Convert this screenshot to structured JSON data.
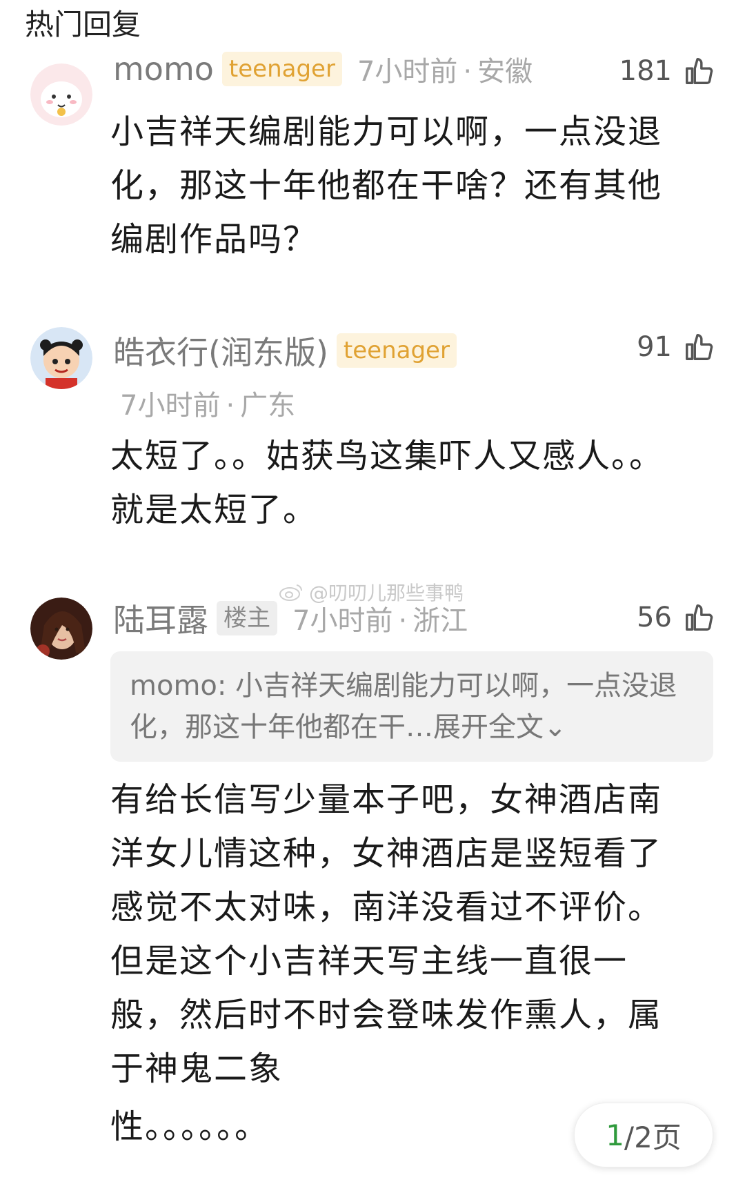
{
  "header": {
    "title": "热门回复"
  },
  "comments": [
    {
      "username": "momo",
      "badge": "teenager",
      "time": "7小时前",
      "location": "安徽",
      "likes": "181",
      "text": "小吉祥天编剧能力可以啊，一点没退化，那这十年他都在干啥？还有其他编剧作品吗？"
    },
    {
      "username": "皓衣行(润东版)",
      "badge": "teenager",
      "time": "7小时前",
      "location": "广东",
      "likes": "91",
      "text": "太短了。。姑获鸟这集吓人又感人。。就是太短了。"
    },
    {
      "username": "陆耳露",
      "badge": "楼主",
      "time": "7小时前",
      "location": "浙江",
      "likes": "56",
      "quote_author": "momo",
      "quote_text": "小吉祥天编剧能力可以啊，一点没退化，那这十年他都在干…",
      "quote_expand": "展开全文",
      "text": "有给长信写少量本子吧，女神酒店南洋女儿情这种，女神酒店是竖短看了感觉不太对味，南洋没看过不评价。但是这个小吉祥天写主线一直很一般，然后时不时会登味发作熏人，属于神鬼二象",
      "text_tail": "性。。。。。。"
    }
  ],
  "watermark": "@叨叨儿那些事鸭",
  "pager": {
    "current": "1",
    "rest": "/2页"
  },
  "colors": {
    "badge_teen_bg": "#fdf3dd",
    "badge_teen_text": "#e0a233",
    "pager_current": "#2f9a3c"
  }
}
